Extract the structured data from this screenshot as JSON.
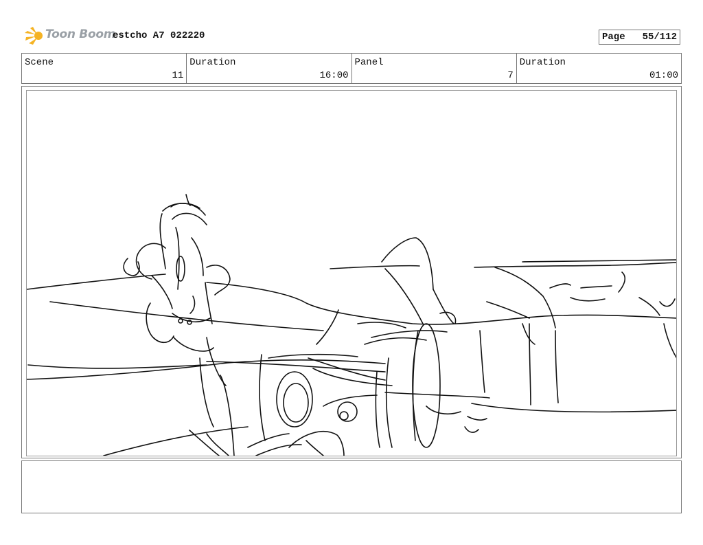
{
  "header": {
    "logo_text": "Toon Boom",
    "project_title": "estcho A7 022220",
    "page_label": "Page",
    "page_value": "55/112"
  },
  "info": {
    "scene_label": "Scene",
    "scene_value": "11",
    "scene_duration_label": "Duration",
    "scene_duration_value": "16:00",
    "panel_label": "Panel",
    "panel_value": "7",
    "panel_duration_label": "Duration",
    "panel_duration_value": "01:00"
  },
  "icons": {
    "logo": "toon-boom-star-icon"
  },
  "colors": {
    "logo_star": "#f5b324",
    "logo_text": "#9aa0a6",
    "border": "#777777"
  },
  "notes": ""
}
